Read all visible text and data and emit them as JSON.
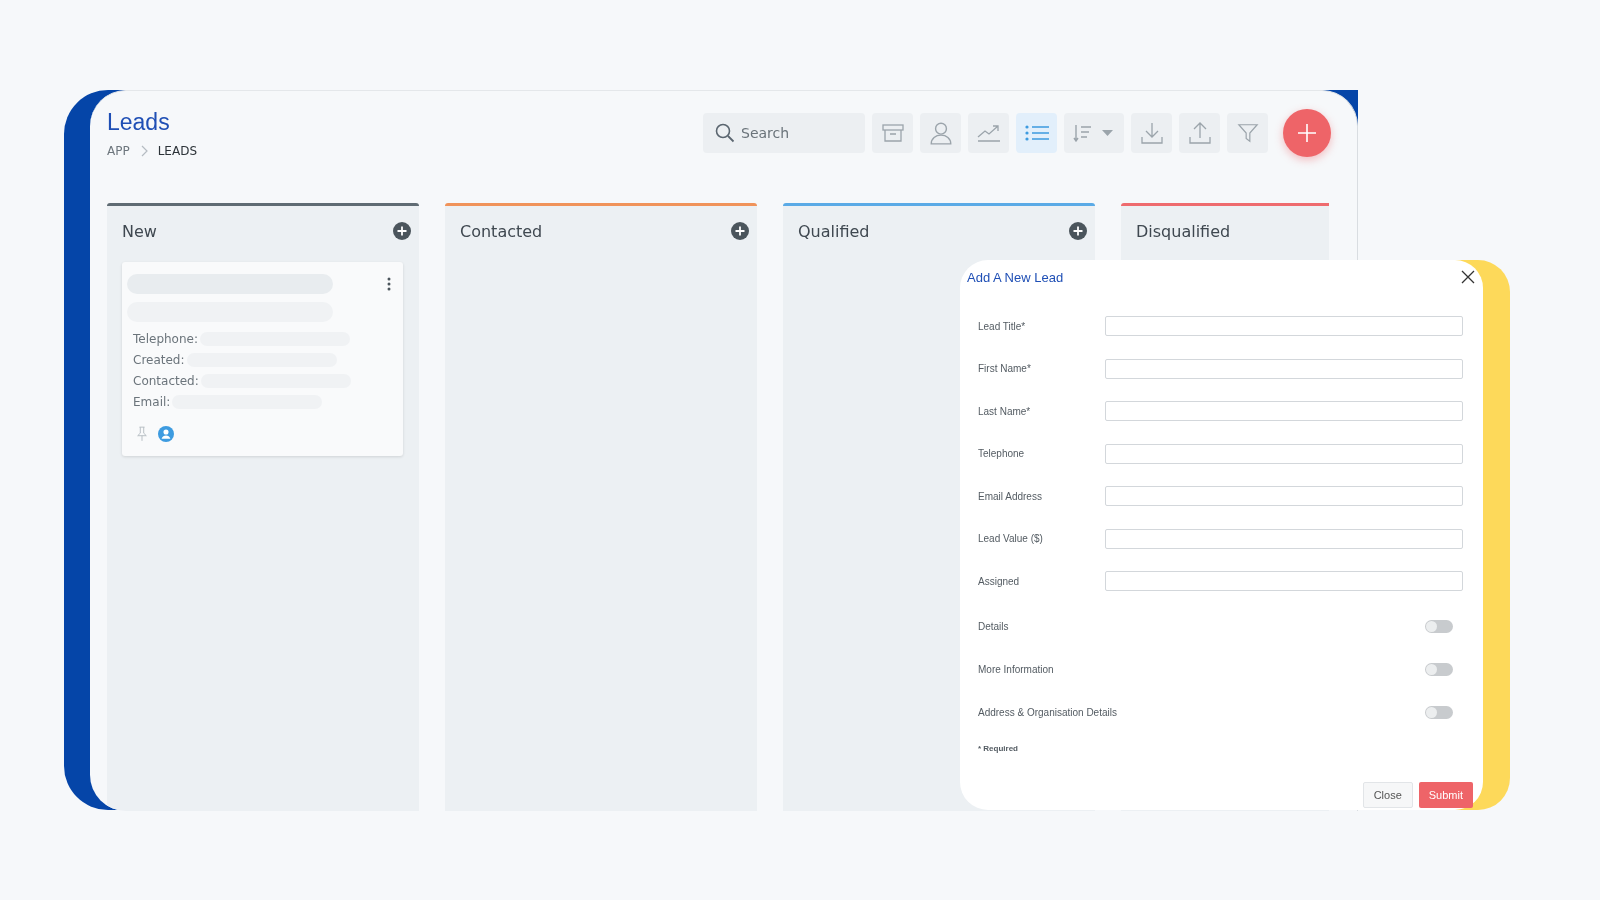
{
  "page": {
    "title": "Leads",
    "breadcrumb": [
      {
        "label": "APP",
        "current": false
      },
      {
        "label": "LEADS",
        "current": true
      }
    ]
  },
  "toolbar": {
    "search": {
      "placeholder": "Search"
    },
    "buttons": [
      {
        "kind": "archive",
        "selected": false
      },
      {
        "kind": "user",
        "selected": false
      },
      {
        "kind": "trend",
        "selected": false
      },
      {
        "kind": "list",
        "selected": true
      },
      {
        "kind": "sort",
        "selected": false
      },
      {
        "kind": "download",
        "selected": false
      },
      {
        "kind": "upload",
        "selected": false
      },
      {
        "kind": "filter",
        "selected": false
      }
    ]
  },
  "columns": [
    {
      "title": "New",
      "color": "#5f6b73",
      "add_button": true,
      "cards": [
        {
          "fields": [
            "Telephone:",
            "Created:",
            "Contacted:",
            "Email:"
          ]
        }
      ]
    },
    {
      "title": "Contacted",
      "color": "#f0935a",
      "add_button": true
    },
    {
      "title": "Qualified",
      "color": "#5aaae6",
      "add_button": true
    },
    {
      "title": "Disqualified",
      "color": "#ee6b6e"
    }
  ],
  "modal": {
    "title": "Add A New Lead",
    "fields": [
      {
        "kind": "text",
        "label": "Lead Title*"
      },
      {
        "kind": "text",
        "label": "First Name*"
      },
      {
        "kind": "text",
        "label": "Last Name*"
      },
      {
        "kind": "text",
        "label": "Telephone"
      },
      {
        "kind": "text",
        "label": "Email Address"
      },
      {
        "kind": "text",
        "label": "Lead Value ($)"
      },
      {
        "kind": "text",
        "label": "Assigned"
      },
      {
        "kind": "toggle",
        "label": "Details",
        "on": false
      },
      {
        "kind": "toggle",
        "label": "More Information",
        "on": false
      },
      {
        "kind": "toggle",
        "label": "Address & Organisation Details",
        "on": false
      }
    ],
    "note": "* Required",
    "buttons": [
      {
        "label": "Close",
        "kind": "secondary"
      },
      {
        "label": "Submit",
        "kind": "primary"
      }
    ]
  }
}
